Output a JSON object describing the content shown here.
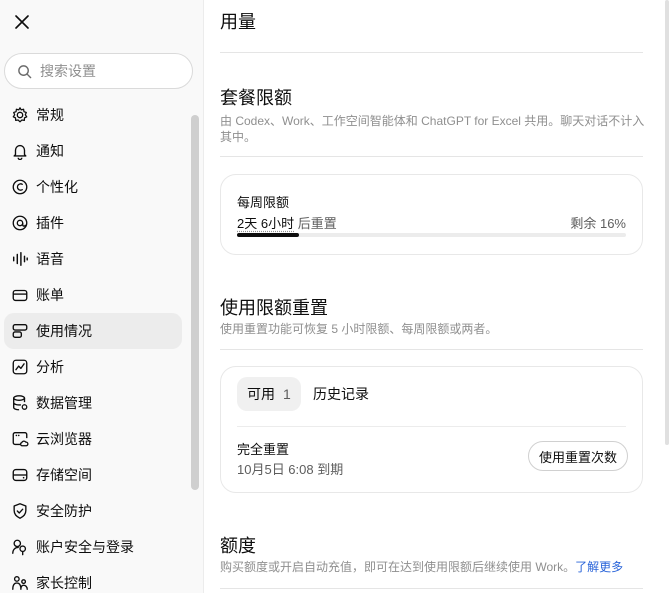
{
  "sidebar": {
    "search_placeholder": "搜索设置",
    "items": [
      {
        "label": "常规",
        "icon": "gear-icon"
      },
      {
        "label": "通知",
        "icon": "bell-icon"
      },
      {
        "label": "个性化",
        "icon": "personalize-icon"
      },
      {
        "label": "插件",
        "icon": "plugin-icon"
      },
      {
        "label": "语音",
        "icon": "voice-icon"
      },
      {
        "label": "账单",
        "icon": "wallet-icon"
      },
      {
        "label": "使用情况",
        "icon": "usage-icon",
        "active": true
      },
      {
        "label": "分析",
        "icon": "chart-icon"
      },
      {
        "label": "数据管理",
        "icon": "database-icon"
      },
      {
        "label": "云浏览器",
        "icon": "cloud-browser-icon"
      },
      {
        "label": "存储空间",
        "icon": "storage-icon"
      },
      {
        "label": "安全防护",
        "icon": "shield-icon"
      },
      {
        "label": "账户安全与登录",
        "icon": "account-security-icon"
      },
      {
        "label": "家长控制",
        "icon": "parental-control-icon"
      }
    ]
  },
  "main": {
    "title": "用量",
    "plan_limits": {
      "title": "套餐限额",
      "description": "由 Codex、Work、工作空间智能体和 ChatGPT for Excel 共用。聊天对话不计入其中。",
      "weekly": {
        "label": "每周限额",
        "reset_time": "2天 6小时",
        "reset_suffix": "后重置",
        "remaining": "剩余 16%",
        "used_fraction": 0.16
      }
    },
    "reset": {
      "title": "使用限额重置",
      "description": "使用重置功能可恢复 5 小时限额、每周限额或两者。",
      "tab_available_label": "可用",
      "tab_available_count": "1",
      "tab_history_label": "历史记录",
      "item_title": "完全重置",
      "item_expiry": "10月5日 6:08 到期",
      "use_button": "使用重置次数"
    },
    "credits": {
      "title": "额度",
      "description": "购买额度或开启自动充值，即可在达到使用限额后继续使用 Work。",
      "learn_more": "了解更多"
    }
  },
  "colors": {
    "sidebar_bg": "#f9f9f9",
    "active_item_bg": "#ececec",
    "link": "#2964d9",
    "progress": "#0d0d0d"
  }
}
